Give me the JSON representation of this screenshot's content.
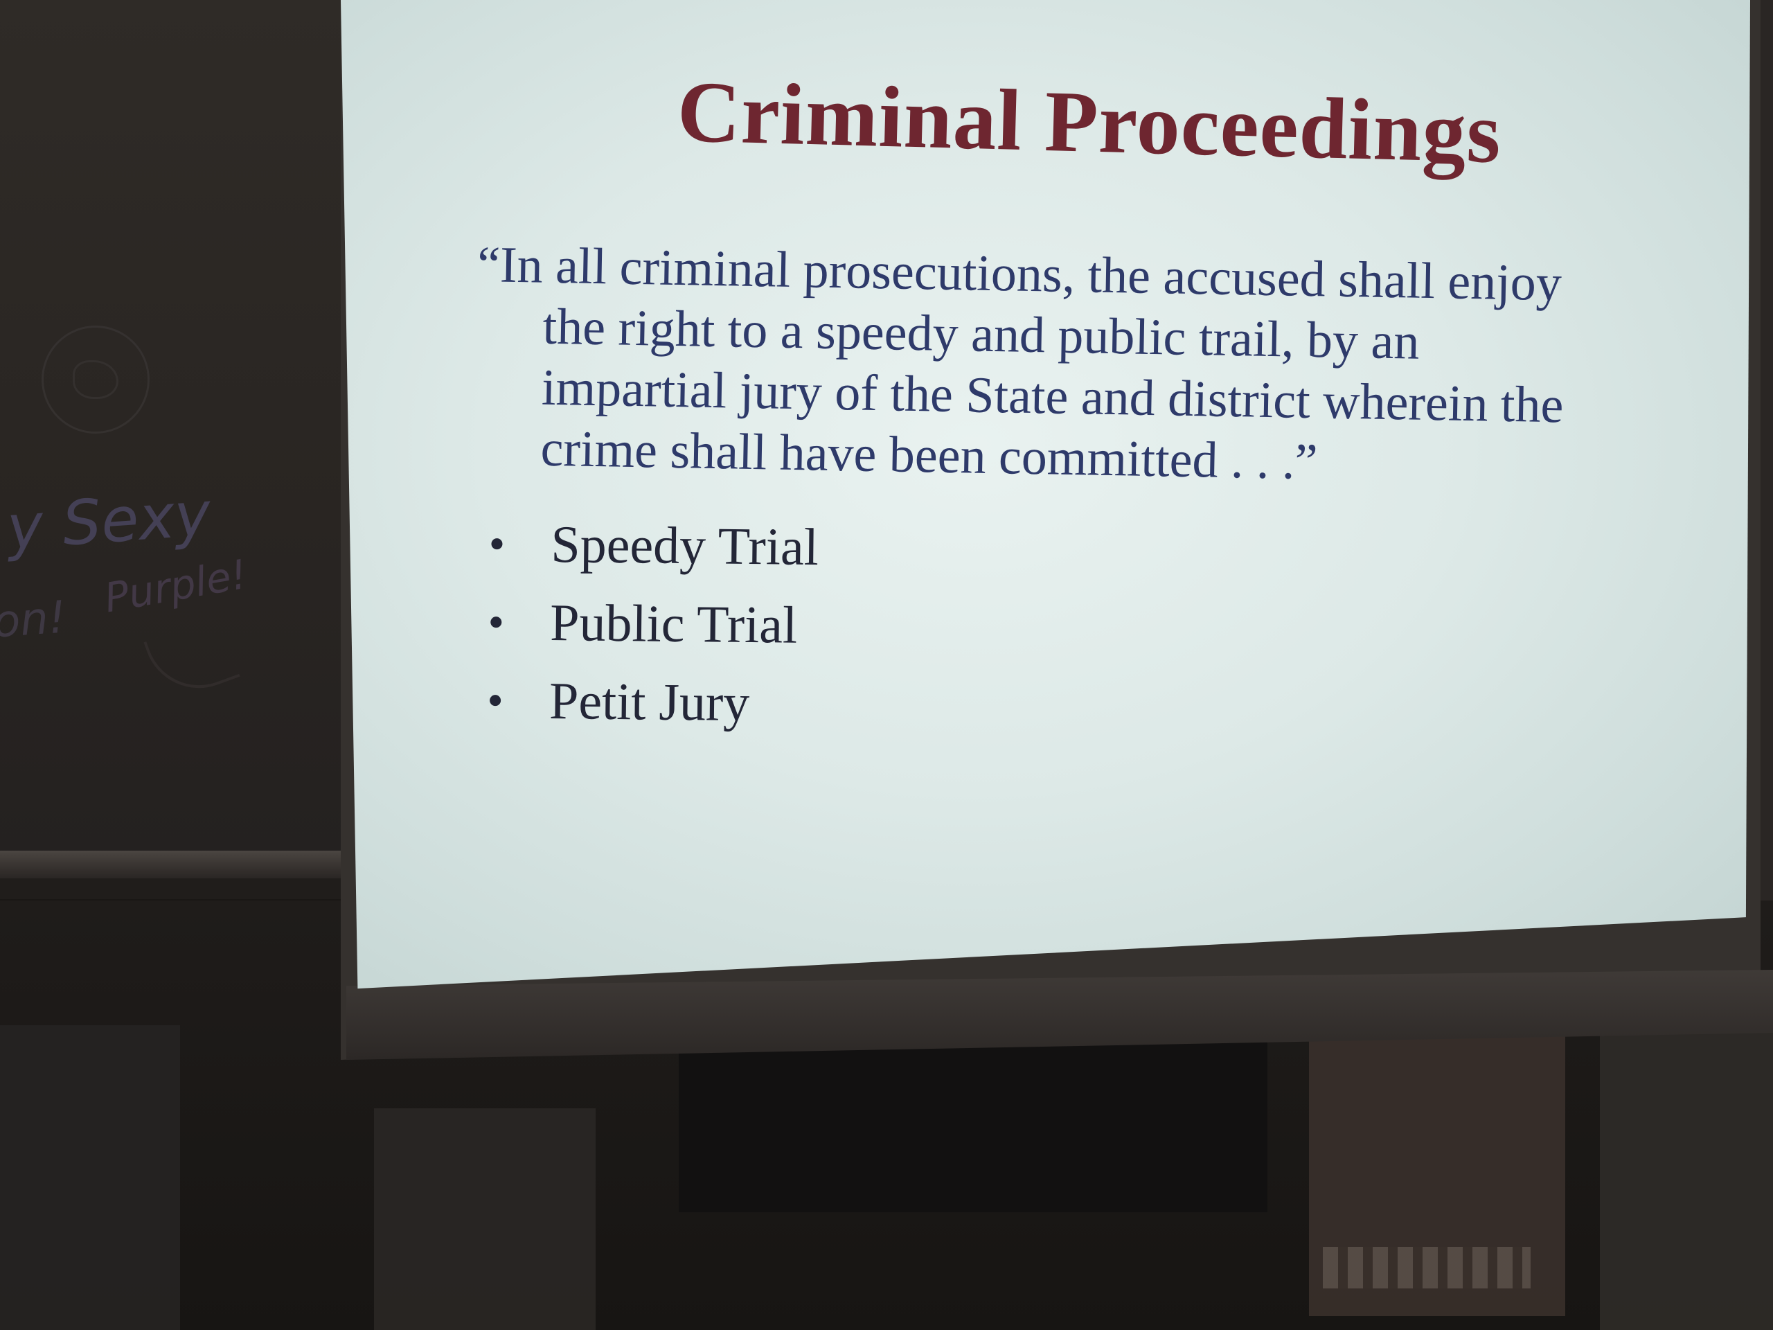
{
  "slide": {
    "title": "Criminal Proceedings",
    "quote_lines": [
      "“In all criminal prosecutions, the accused shall enjoy",
      "the right to a speedy and public trail, by an",
      "impartial jury of the State and district wherein the",
      "crime shall have been committed . . .”"
    ],
    "bullets": [
      "Speedy Trial",
      "Public Trial",
      "Petit Jury"
    ]
  },
  "whiteboard": {
    "scribbles": [
      "y Sexy",
      "Purple!",
      "on!"
    ]
  },
  "colors": {
    "title": "#6e2630",
    "quote_text": "#2e3a6a",
    "bullet_text": "#232637",
    "screen": "#dde9e7"
  }
}
